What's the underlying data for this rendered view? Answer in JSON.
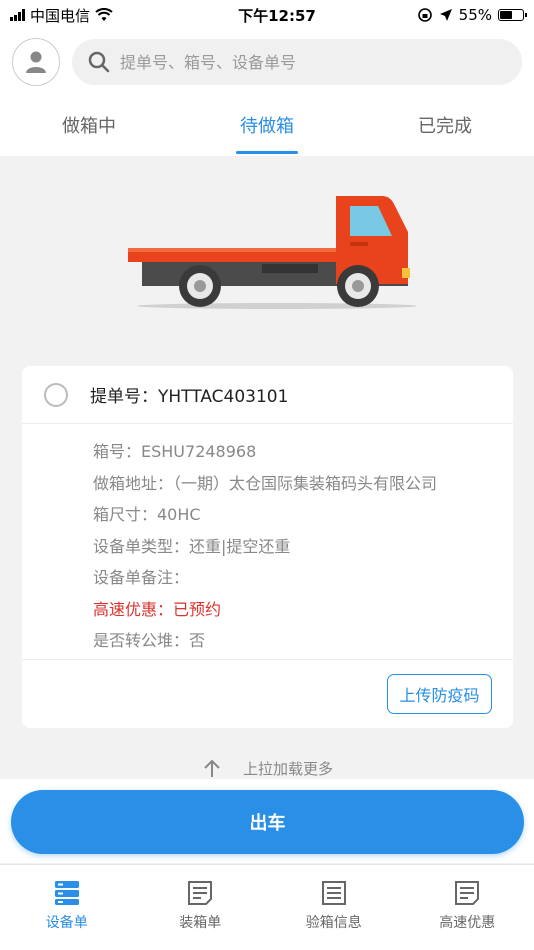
{
  "status_bar": {
    "carrier": "中国电信",
    "time": "下午12:57",
    "battery": "55%",
    "battery_level": 0.55
  },
  "header": {
    "avatar_icon": "user-icon",
    "search_placeholder": "提单号、箱号、设备单号"
  },
  "tabs": [
    {
      "label": "做箱中",
      "active": false
    },
    {
      "label": "待做箱",
      "active": true
    },
    {
      "label": "已完成",
      "active": false
    }
  ],
  "card": {
    "title": "提单号：YHTTAC403101",
    "rows": [
      "箱号：ESHU7248968",
      "做箱地址：（一期）太仓国际集装箱码头有限公司",
      "箱尺寸：40HC",
      "设备单类型：还重|提空还重",
      "设备单备注：",
      "高速优惠：已预约",
      "是否转公堆：否"
    ],
    "upload_button": "上传防疫码"
  },
  "load_more": "上拉加载更多",
  "depart_button": "出车",
  "bottom_nav": [
    {
      "label": "设备单",
      "icon": "device-list-icon",
      "active": true
    },
    {
      "label": "装箱单",
      "icon": "document-icon",
      "active": false
    },
    {
      "label": "验箱信息",
      "icon": "document-icon",
      "active": false
    },
    {
      "label": "高速优惠",
      "icon": "document-icon",
      "active": false
    }
  ],
  "colors": {
    "accent": "#2a8fe6",
    "highlight": "#d9332e",
    "truck_cab": "#e8431d"
  }
}
